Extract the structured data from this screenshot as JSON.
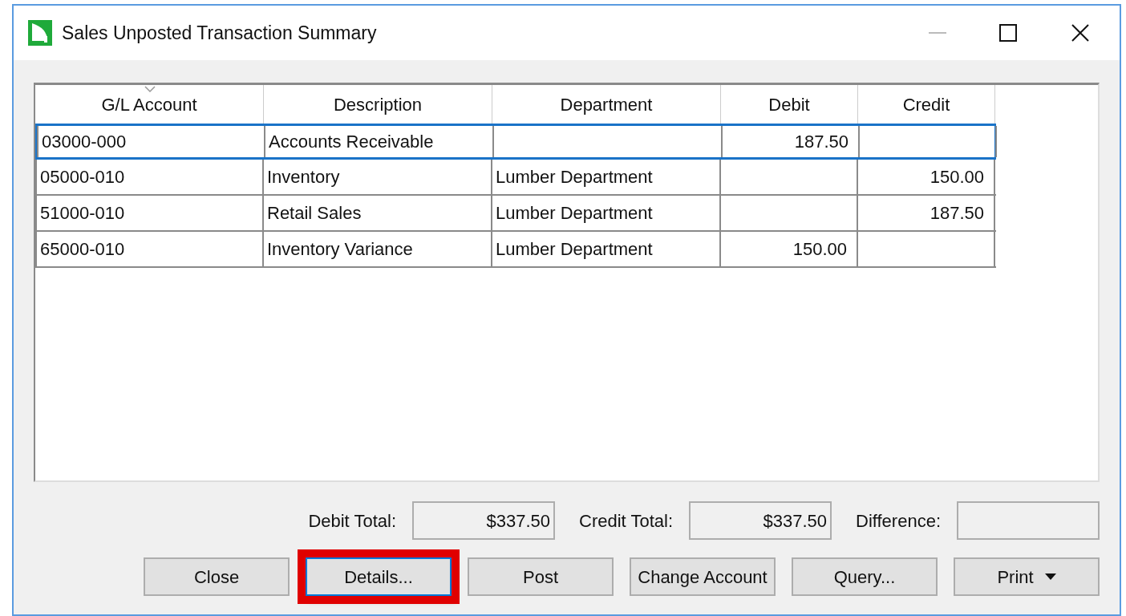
{
  "window": {
    "title": "Sales Unposted Transaction Summary"
  },
  "table": {
    "columns": [
      {
        "label": "G/L Account",
        "sorted": true
      },
      {
        "label": "Description",
        "sorted": false
      },
      {
        "label": "Department",
        "sorted": false
      },
      {
        "label": "Debit",
        "sorted": false
      },
      {
        "label": "Credit",
        "sorted": false
      }
    ],
    "rows": [
      {
        "selected": true,
        "cells": [
          "03000-000",
          "Accounts Receivable",
          "",
          "187.50",
          ""
        ]
      },
      {
        "selected": false,
        "cells": [
          "05000-010",
          "Inventory",
          "Lumber Department",
          "",
          "150.00"
        ]
      },
      {
        "selected": false,
        "cells": [
          "51000-010",
          "Retail Sales",
          "Lumber Department",
          "",
          "187.50"
        ]
      },
      {
        "selected": false,
        "cells": [
          "65000-010",
          "Inventory Variance",
          "Lumber Department",
          "150.00",
          ""
        ]
      }
    ]
  },
  "totals": [
    {
      "label": "Debit Total:",
      "value": "$337.50"
    },
    {
      "label": "Credit Total:",
      "value": "$337.50"
    },
    {
      "label": "Difference:"
    }
  ],
  "buttons": [
    {
      "label": "Close",
      "kind": "plain",
      "highlighted": false
    },
    {
      "label": "Details...",
      "kind": "plain",
      "highlighted": true
    },
    {
      "label": "Post",
      "kind": "plain",
      "highlighted": false
    },
    {
      "label": "Change Account",
      "kind": "plain",
      "highlighted": false
    },
    {
      "label": "Query...",
      "kind": "plain",
      "highlighted": false
    },
    {
      "label": "Print",
      "kind": "dropdown",
      "highlighted": false
    }
  ]
}
